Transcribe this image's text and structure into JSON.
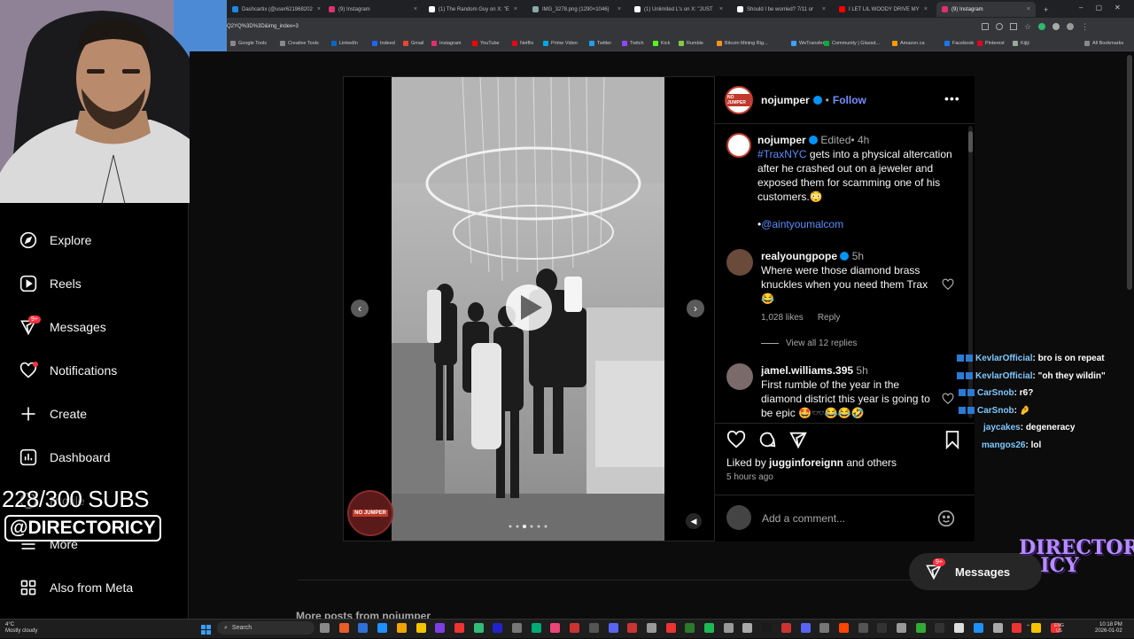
{
  "browser": {
    "tabs": [
      {
        "title": "Dashcartix (@user621968202",
        "color": "#1e88e5"
      },
      {
        "title": "(9) Instagram",
        "color": "#e1306c"
      },
      {
        "title": "(1) The Random Guy on X: \"E",
        "color": "#ffffff"
      },
      {
        "title": "IMG_3278.png (1290×1046)",
        "color": "#8aa"
      },
      {
        "title": "(1) Unlimited L's on X: \"JUST",
        "color": "#ffffff"
      },
      {
        "title": "Should I be worried? 7/11 or",
        "color": "#ffffff"
      },
      {
        "title": "I LET LIL WOODY DRIVE MY",
        "color": "#ff0000"
      },
      {
        "title": "(9) Instagram",
        "color": "#e1306c"
      }
    ],
    "url": "Q2YQ%3D%3D&img_index=3",
    "bookmarks": [
      {
        "label": "Google Tools",
        "color": "#888"
      },
      {
        "label": "Creative Tools",
        "color": "#888"
      },
      {
        "label": "LinkedIn",
        "color": "#0a66c2"
      },
      {
        "label": "Indeed",
        "color": "#2164f3"
      },
      {
        "label": "Gmail",
        "color": "#ea4335"
      },
      {
        "label": "Instagram",
        "color": "#e1306c"
      },
      {
        "label": "YouTube",
        "color": "#ff0000"
      },
      {
        "label": "Netflix",
        "color": "#e50914"
      },
      {
        "label": "Prime Video",
        "color": "#00a8e1"
      },
      {
        "label": "Twitter",
        "color": "#1da1f2"
      },
      {
        "label": "Twitch",
        "color": "#9146ff"
      },
      {
        "label": "Kick",
        "color": "#53fc18"
      },
      {
        "label": "Rumble",
        "color": "#85c742"
      },
      {
        "label": "Bitcoin Mining Rig...",
        "color": "#f7931a"
      },
      {
        "label": "WeTransfer",
        "color": "#409fff"
      },
      {
        "label": "Community | Glassd...",
        "color": "#0caa41"
      },
      {
        "label": "Amazon.ca",
        "color": "#ff9900"
      },
      {
        "label": "Facebook",
        "color": "#1877f2"
      },
      {
        "label": "Pinterest",
        "color": "#e60023"
      },
      {
        "label": "Kijiji",
        "color": "#9a9"
      }
    ],
    "all_bookmarks": "All Bookmarks"
  },
  "stream_overlay": {
    "subs": "228/300 SUBS",
    "handle": "@DIRECTORICY",
    "logo_text": "DIRECTOR ICY"
  },
  "sidebar": {
    "items": [
      {
        "label": "Explore",
        "icon": "compass-icon"
      },
      {
        "label": "Reels",
        "icon": "reels-icon"
      },
      {
        "label": "Messages",
        "icon": "messages-icon",
        "badge": "9+"
      },
      {
        "label": "Notifications",
        "icon": "heart-icon"
      },
      {
        "label": "Create",
        "icon": "plus-icon"
      },
      {
        "label": "Dashboard",
        "icon": "dashboard-icon"
      },
      {
        "label": "Profile",
        "icon": "profile-icon"
      },
      {
        "label": "More",
        "icon": "menu-icon"
      },
      {
        "label": "Also from Meta",
        "icon": "meta-icon"
      }
    ]
  },
  "post": {
    "author": "nojumper",
    "follow": "Follow",
    "dot": "•",
    "caption": {
      "author": "nojumper",
      "edited": "Edited",
      "time": "4h",
      "hashtag": "#TraxNYC",
      "text": " gets into a physical altercation after he crashed out on a jeweler and exposed them for scamming one of his customers.😳",
      "mention": "@aintyoumalcom",
      "mention_prefix": "•"
    },
    "comments": [
      {
        "author": "realyoungpope",
        "time": "5h",
        "text": "Where were those diamond brass knuckles when you need them Trax 😂",
        "likes": "1,028 likes",
        "reply": "Reply",
        "view_replies": "View all 12 replies"
      },
      {
        "author": "jamel.williams.395",
        "time": "5h",
        "text": "First rumble of the year in the diamond district this year is going to be epic 🤩🕶️😂😂🤣"
      }
    ],
    "liked_by_prefix": "Liked by ",
    "liked_by_user": "jugginforeignn",
    "liked_by_suffix": " and others",
    "posted": "5 hours ago",
    "comment_placeholder": "Add a comment...",
    "watermark": "NO JUMPER"
  },
  "more_posts": "More posts from nojumper",
  "float_messages": {
    "label": "Messages",
    "badge": "9+"
  },
  "chat": [
    {
      "name": "KevlarOfficial",
      "msg": ": bro is on repeat"
    },
    {
      "name": "KevlarOfficial",
      "msg": ": \"oh they wildin\""
    },
    {
      "name": "CarSnob",
      "msg": ": r6?"
    },
    {
      "name": "CarSnob",
      "msg": ": 🤌"
    },
    {
      "name": "jaycakes",
      "msg": ": degeneracy"
    },
    {
      "name": "mangos26",
      "msg": ": lol"
    }
  ],
  "taskbar": {
    "weather_temp": "4°C",
    "weather_desc": "Mostly cloudy",
    "search": "Search",
    "lang": "ENG",
    "region": "US",
    "time": "10:18 PM",
    "date": "2026-01-02"
  }
}
